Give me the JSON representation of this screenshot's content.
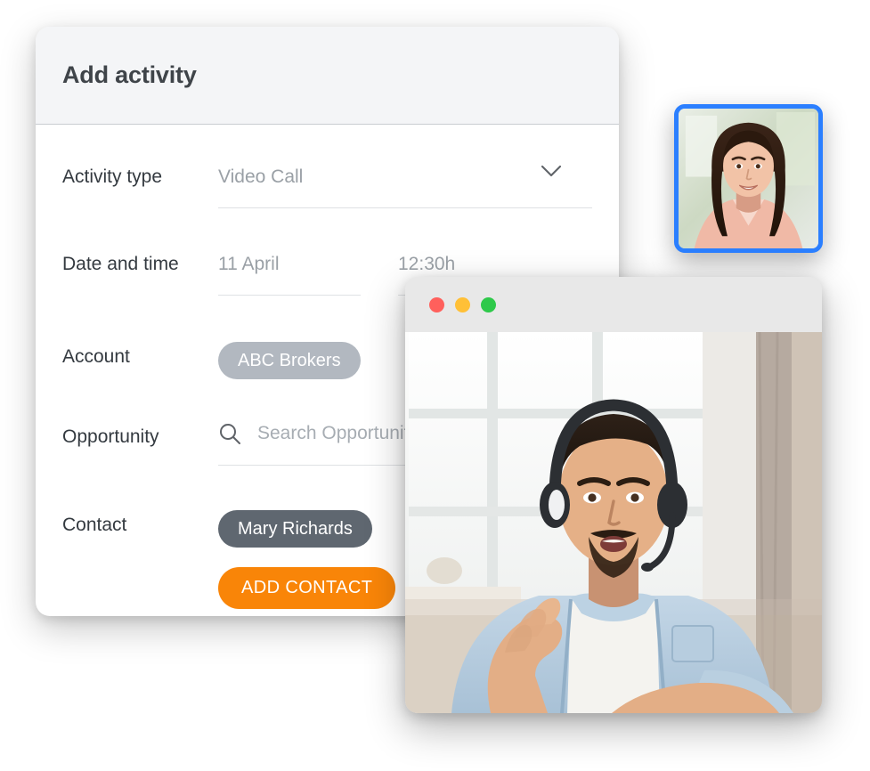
{
  "form": {
    "title": "Add activity",
    "fields": [
      {
        "label": "Activity type",
        "value": "Video Call",
        "icon": "chevron-down-icon"
      },
      {
        "label": "Date and time",
        "date": "11 April",
        "time": "12:30h"
      },
      {
        "label": "Account",
        "chip": "ABC Brokers"
      },
      {
        "label": "Opportunity",
        "placeholder": "Search Opportunity",
        "icon": "search-icon"
      },
      {
        "label": "Contact",
        "chip": "Mary Richards",
        "button": "ADD CONTACT"
      }
    ]
  },
  "video_window": {
    "traffic_lights": [
      "close",
      "minimize",
      "maximize"
    ],
    "participant": "man with headset on video call"
  },
  "self_view": {
    "participant": "woman smiling",
    "border_color": "#2b7fff"
  },
  "colors": {
    "accent_orange": "#f98508",
    "chip_account": "#b2b8c0",
    "chip_contact": "#5f6770",
    "header_bg": "#f4f5f7",
    "label_text": "#343a40",
    "value_text": "#9aa0a6",
    "traffic_red": "#ff605c",
    "traffic_yellow": "#ffc037",
    "traffic_green": "#2ec94a"
  }
}
